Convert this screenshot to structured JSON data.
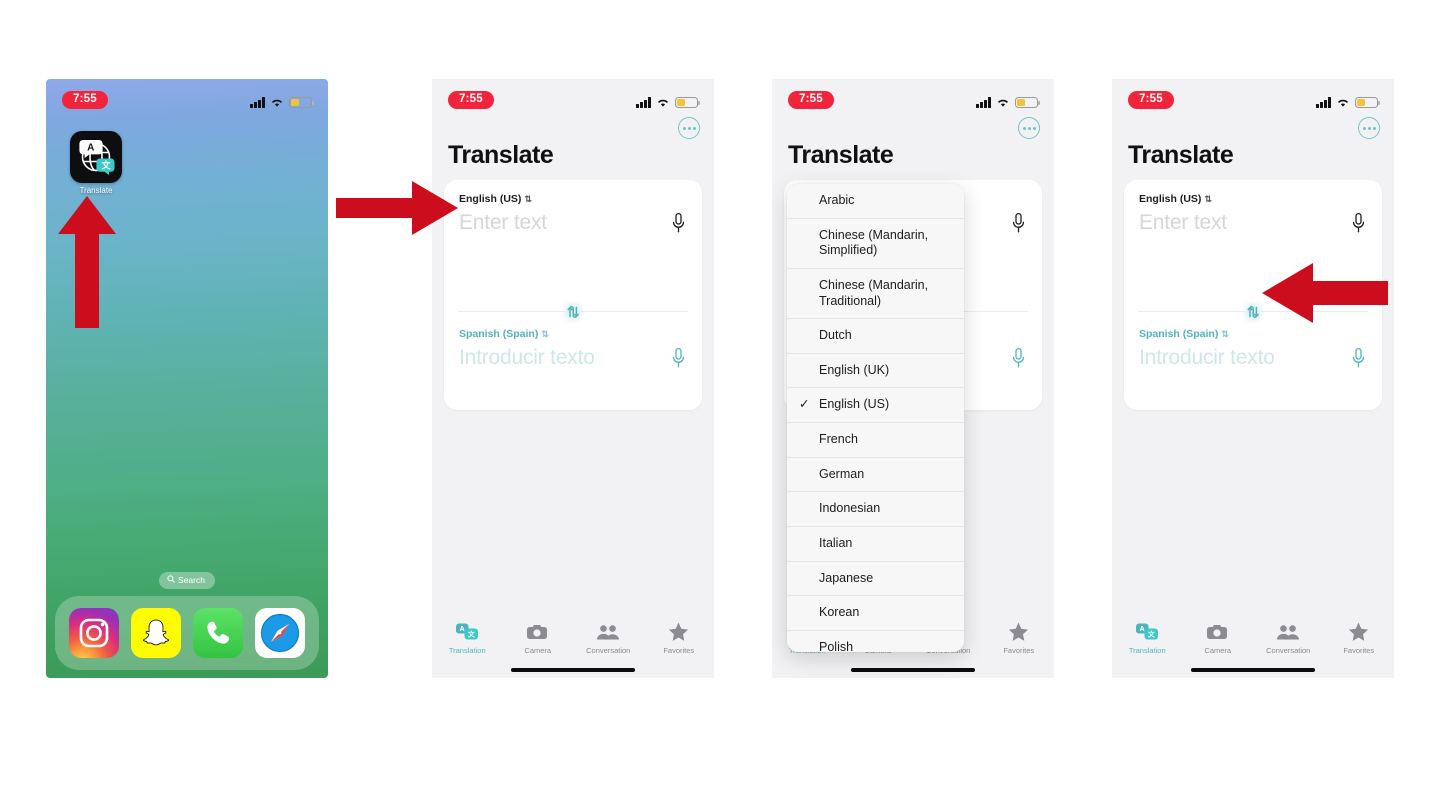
{
  "statusbar": {
    "time": "7:55",
    "signal_icon": "cellular-bars-icon",
    "wifi_icon": "wifi-icon",
    "battery_icon": "battery-low-icon"
  },
  "colors": {
    "accent_teal": "#4fb3bd",
    "arrow_red": "#cc0d1e",
    "time_pill_red": "#f2243b",
    "battery_yellow": "#f2c33c"
  },
  "home_screen": {
    "app": {
      "label": "Translate",
      "icon": "translate-app-icon",
      "badge_letter": "A",
      "badge_cjk": "文"
    },
    "search": {
      "label": "Search",
      "icon": "search-icon"
    },
    "dock": [
      {
        "name": "instagram",
        "label": "Instagram",
        "icon": "instagram-icon"
      },
      {
        "name": "snapchat",
        "label": "Snapchat",
        "icon": "snapchat-ghost-icon"
      },
      {
        "name": "phone",
        "label": "Phone",
        "icon": "phone-handset-icon"
      },
      {
        "name": "safari",
        "label": "Safari",
        "icon": "safari-compass-icon"
      }
    ]
  },
  "translate_app": {
    "title": "Translate",
    "more_button": "more-ellipsis-icon",
    "source": {
      "language": "English (US)",
      "placeholder": "Enter text",
      "mic_icon": "microphone-icon"
    },
    "target": {
      "language": "Spanish (Spain)",
      "placeholder": "Introducir texto",
      "mic_icon": "microphone-icon"
    },
    "swap_button": "swap-languages-icon",
    "tabs": [
      {
        "label": "Translation",
        "icon": "translation-bubbles-icon",
        "active": true
      },
      {
        "label": "Camera",
        "icon": "camera-icon",
        "active": false
      },
      {
        "label": "Conversation",
        "icon": "people-icon",
        "active": false
      },
      {
        "label": "Favorites",
        "icon": "star-icon",
        "active": false
      }
    ]
  },
  "language_dropdown": {
    "selected": "English (US)",
    "items": [
      {
        "label": "Arabic",
        "checked": false
      },
      {
        "label": "Chinese (Mandarin, Simplified)",
        "checked": false
      },
      {
        "label": "Chinese (Mandarin, Traditional)",
        "checked": false
      },
      {
        "label": "Dutch",
        "checked": false
      },
      {
        "label": "English (UK)",
        "checked": false
      },
      {
        "label": "English (US)",
        "checked": true
      },
      {
        "label": "French",
        "checked": false
      },
      {
        "label": "German",
        "checked": false
      },
      {
        "label": "Indonesian",
        "checked": false
      },
      {
        "label": "Italian",
        "checked": false
      },
      {
        "label": "Japanese",
        "checked": false
      },
      {
        "label": "Korean",
        "checked": false
      },
      {
        "label": "Polish",
        "checked": false
      }
    ]
  },
  "annotations": [
    {
      "name": "arrow-to-translate-app",
      "direction": "up"
    },
    {
      "name": "arrow-to-source-language",
      "direction": "right"
    },
    {
      "name": "arrow-to-swap-button",
      "direction": "left"
    }
  ]
}
